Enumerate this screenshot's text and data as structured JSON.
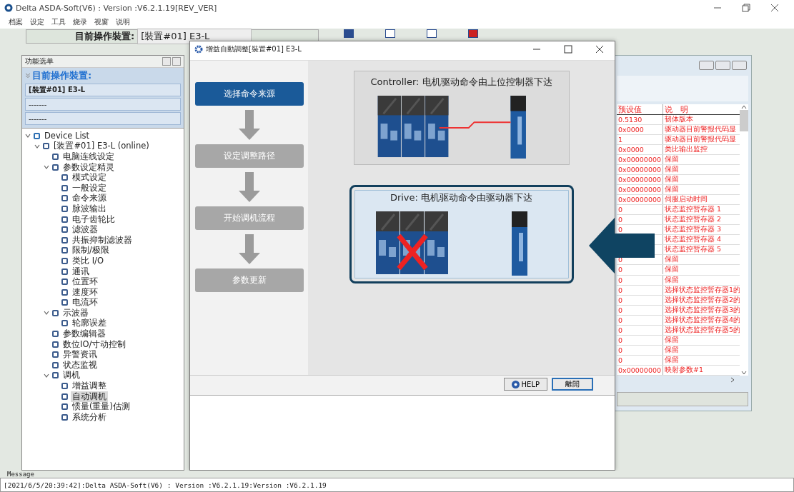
{
  "window": {
    "title": "Delta ASDA-Soft(V6) : Version :V6.2.1.19[REV_VER]"
  },
  "menu": [
    "档案",
    "设定",
    "工具",
    "烧录",
    "视窗",
    "说明"
  ],
  "device_bar": {
    "label": "目前操作裝置:",
    "value": "[裝置#01] E3-L"
  },
  "function_panel": {
    "title": "功能选单",
    "header": "目前操作裝置:",
    "devices": [
      "[裝置#01] E3-L",
      "-------",
      "-------"
    ],
    "tree": [
      {
        "label": "Device List",
        "expanded": true,
        "selected": false,
        "children": [
          {
            "label": "[装置#01] E3-L (online)",
            "expanded": true,
            "selected": false,
            "children": [
              {
                "label": "电脑连线设定",
                "selected": false
              },
              {
                "label": "参数设定精灵",
                "expanded": true,
                "selected": false,
                "children": [
                  {
                    "label": "模式设定",
                    "selected": false
                  },
                  {
                    "label": "一般设定",
                    "selected": false
                  },
                  {
                    "label": "命令来源",
                    "selected": false
                  },
                  {
                    "label": "脉波输出",
                    "selected": false
                  },
                  {
                    "label": "电子齿轮比",
                    "selected": false
                  },
                  {
                    "label": "滤波器",
                    "selected": false
                  },
                  {
                    "label": "共振抑制滤波器",
                    "selected": false
                  },
                  {
                    "label": "限制/极限",
                    "selected": false
                  },
                  {
                    "label": "类比 I/O",
                    "selected": false
                  },
                  {
                    "label": "通讯",
                    "selected": false
                  },
                  {
                    "label": "位置环",
                    "selected": false
                  },
                  {
                    "label": "速度环",
                    "selected": false
                  },
                  {
                    "label": "电流环",
                    "selected": false
                  }
                ]
              },
              {
                "label": "示波器",
                "expanded": true,
                "selected": false,
                "children": [
                  {
                    "label": "轮廓误差",
                    "selected": false
                  }
                ]
              },
              {
                "label": "参数编辑器",
                "selected": false
              },
              {
                "label": "数位IO/寸动控制",
                "selected": false
              },
              {
                "label": "异警资讯",
                "selected": false
              },
              {
                "label": "状态监视",
                "selected": false
              },
              {
                "label": "调机",
                "expanded": true,
                "selected": false,
                "children": [
                  {
                    "label": "增益调整",
                    "selected": false
                  },
                  {
                    "label": "自动调机",
                    "selected": true
                  },
                  {
                    "label": "惯量(重量)估测",
                    "selected": false
                  },
                  {
                    "label": "系统分析",
                    "selected": false
                  }
                ]
              }
            ]
          }
        ]
      }
    ]
  },
  "param_table": {
    "columns": [
      "预设值",
      "说　明"
    ],
    "rows": [
      {
        "value": "0.5130",
        "desc": "韧体版本"
      },
      {
        "value": "0x0000",
        "desc": "驱动器目前警报代码显"
      },
      {
        "value": "1",
        "desc": "驱动器目前警报代码显"
      },
      {
        "value": "0x0000",
        "desc": "类比输出监控"
      },
      {
        "value": "0x00000000",
        "desc": "保留"
      },
      {
        "value": "0x00000000",
        "desc": "保留"
      },
      {
        "value": "0x00000000",
        "desc": "保留"
      },
      {
        "value": "0x00000000",
        "desc": "保留"
      },
      {
        "value": "0x00000000",
        "desc": "伺服启动时间"
      },
      {
        "value": "0",
        "desc": "状态监控暂存器 1"
      },
      {
        "value": "0",
        "desc": "状态监控暂存器 2"
      },
      {
        "value": "0",
        "desc": "状态监控暂存器 3"
      },
      {
        "desc": "状态监控暂存器 4"
      },
      {
        "desc": "状态监控暂存器 5"
      },
      {
        "value": "0",
        "desc": "保留"
      },
      {
        "value": "0",
        "desc": "保留"
      },
      {
        "value": "0",
        "desc": "保留"
      },
      {
        "value": "0",
        "desc": "选择状态监控暂存器1的"
      },
      {
        "value": "0",
        "desc": "选择状态监控暂存器2的"
      },
      {
        "value": "0",
        "desc": "选择状态监控暂存器3的"
      },
      {
        "value": "0",
        "desc": "选择状态监控暂存器4的"
      },
      {
        "value": "0",
        "desc": "选择状态监控暂存器5的"
      },
      {
        "value": "0",
        "desc": "保留"
      },
      {
        "value": "0",
        "desc": "保留"
      },
      {
        "value": "0",
        "desc": "保留"
      },
      {
        "value": "0x00000000",
        "desc": "映射参数#1"
      }
    ]
  },
  "dialog": {
    "title": "增益自動調整[裝置#01] E3-L",
    "steps": [
      {
        "label": "选择命令来源",
        "selected": true
      },
      {
        "label": "设定调整路径",
        "selected": false
      },
      {
        "label": "开始调机流程",
        "selected": false
      },
      {
        "label": "参数更新",
        "selected": false
      }
    ],
    "options": [
      {
        "kind": "controller",
        "label": "Controller: 电机驱动命令由上位控制器下达",
        "selected": false
      },
      {
        "kind": "drive",
        "label": "Drive: 电机驱动命令由驱动器下达",
        "selected": true
      }
    ],
    "buttons": [
      "HELP",
      "離開"
    ]
  },
  "message": {
    "title": "Message",
    "text": "[2021/6/5/20:39:42]:Delta ASDA-Soft(V6) : Version :V6.2.1.19:Version :V6.2.1.19"
  }
}
